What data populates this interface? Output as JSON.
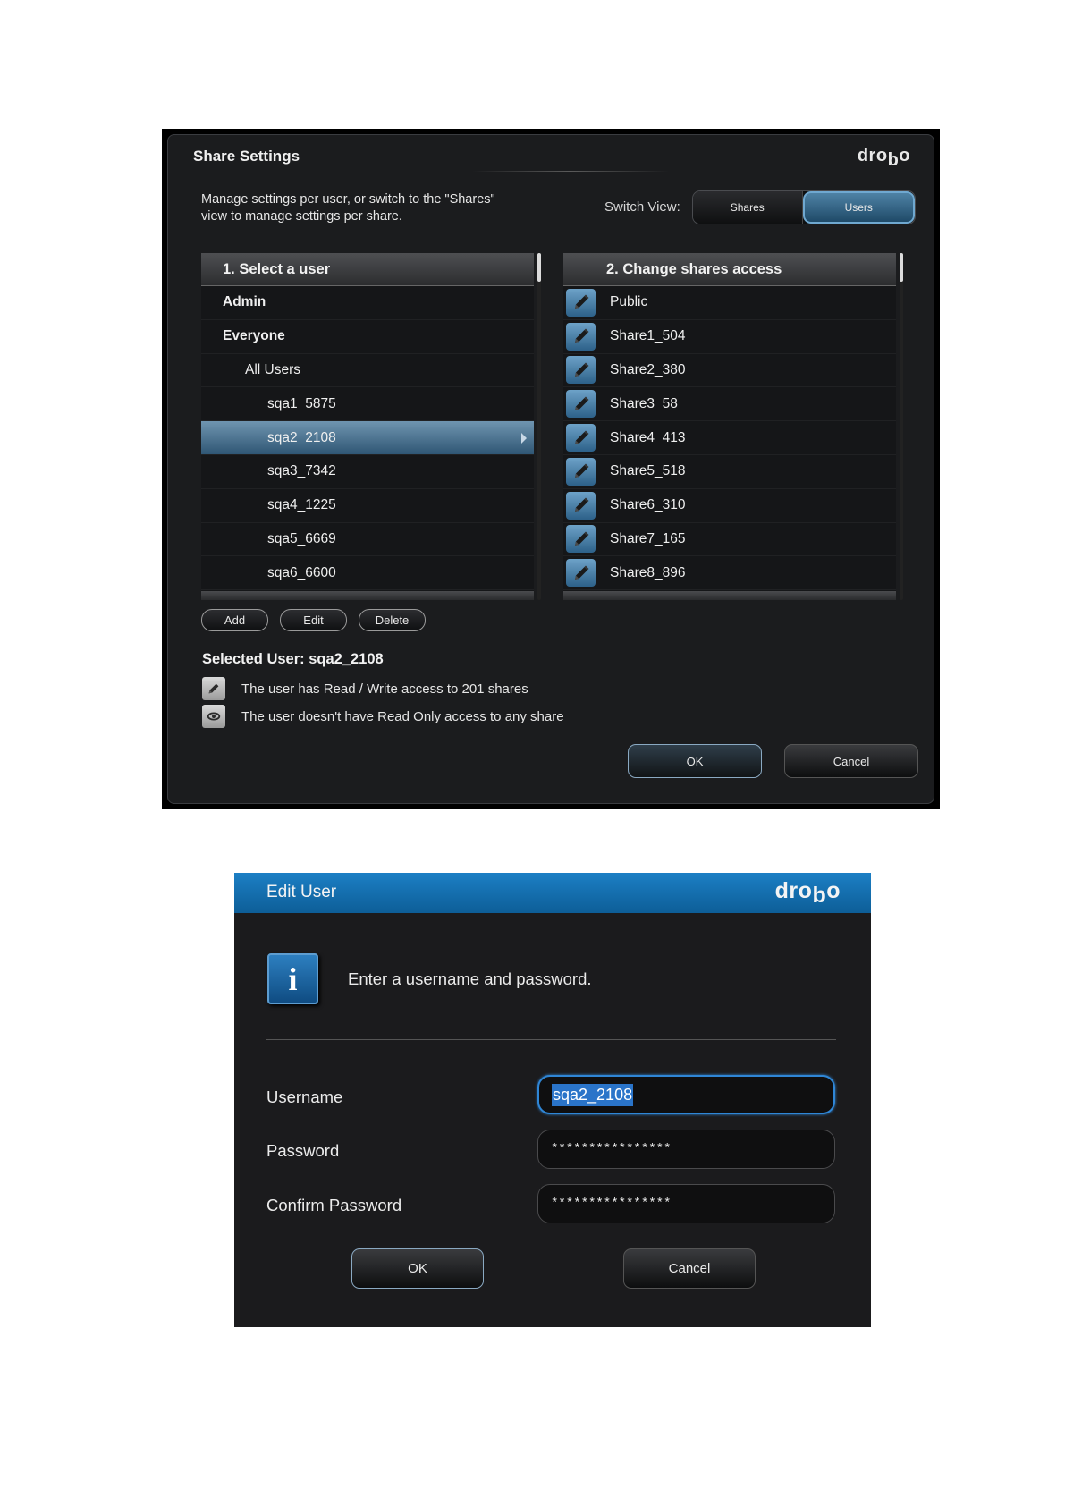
{
  "share_settings": {
    "title": "Share Settings",
    "logo_main": "dro",
    "logo_b": "b",
    "logo_end": "o",
    "description": "Manage settings per user, or switch to the \"Shares\" view to manage settings per share.",
    "switch_view_label": "Switch View:",
    "switch_options": [
      "Shares",
      "Users"
    ],
    "switch_selected": "Users",
    "users_panel": {
      "header": "1. Select a user",
      "items": [
        {
          "label": "Admin",
          "indent": 0,
          "bold": true,
          "selected": false
        },
        {
          "label": "Everyone",
          "indent": 0,
          "bold": true,
          "selected": false
        },
        {
          "label": "All Users",
          "indent": 1,
          "bold": false,
          "selected": false
        },
        {
          "label": "sqa1_5875",
          "indent": 2,
          "bold": false,
          "selected": false
        },
        {
          "label": "sqa2_2108",
          "indent": 2,
          "bold": false,
          "selected": true
        },
        {
          "label": "sqa3_7342",
          "indent": 2,
          "bold": false,
          "selected": false
        },
        {
          "label": "sqa4_1225",
          "indent": 2,
          "bold": false,
          "selected": false
        },
        {
          "label": "sqa5_6669",
          "indent": 2,
          "bold": false,
          "selected": false
        },
        {
          "label": "sqa6_6600",
          "indent": 2,
          "bold": false,
          "selected": false
        }
      ]
    },
    "shares_panel": {
      "header": "2. Change shares access",
      "items": [
        {
          "label": "Public",
          "icon": "pencil-icon"
        },
        {
          "label": "Share1_504",
          "icon": "pencil-icon"
        },
        {
          "label": "Share2_380",
          "icon": "pencil-icon"
        },
        {
          "label": "Share3_58",
          "icon": "pencil-icon"
        },
        {
          "label": "Share4_413",
          "icon": "pencil-icon"
        },
        {
          "label": "Share5_518",
          "icon": "pencil-icon"
        },
        {
          "label": "Share6_310",
          "icon": "pencil-icon"
        },
        {
          "label": "Share7_165",
          "icon": "pencil-icon"
        },
        {
          "label": "Share8_896",
          "icon": "pencil-icon"
        }
      ]
    },
    "buttons": {
      "add": "Add",
      "edit": "Edit",
      "delete": "Delete",
      "ok": "OK",
      "cancel": "Cancel"
    },
    "selected_user_text": "Selected User: sqa2_2108",
    "legend": {
      "read_write": "The user has Read / Write access to 201 shares",
      "read_only": "The user doesn't have Read Only access to any share"
    },
    "colors": {
      "accent": "#6fa8d0",
      "selected_row": "#4f7694",
      "background": "#1b1c1e"
    }
  },
  "edit_user": {
    "title": "Edit User",
    "logo_main": "dro",
    "logo_b": "b",
    "logo_end": "o",
    "message": "Enter a username and password.",
    "fields": {
      "username_label": "Username",
      "username_value": "sqa2_2108",
      "password_label": "Password",
      "password_value": "****************",
      "confirm_label": "Confirm Password",
      "confirm_value": "****************"
    },
    "buttons": {
      "ok": "OK",
      "cancel": "Cancel"
    },
    "colors": {
      "title_bar": "#1574b8",
      "focus_ring": "#2f86d6"
    }
  }
}
